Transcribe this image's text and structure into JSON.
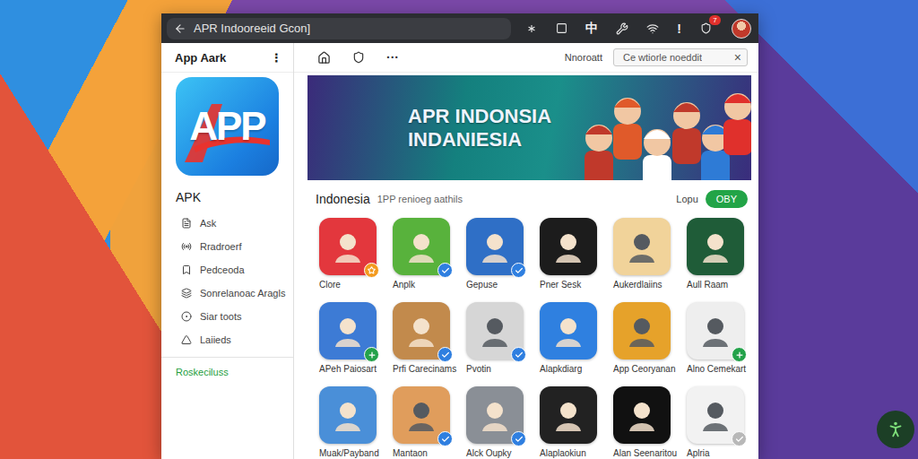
{
  "window": {
    "address": "APR Indooreeid Gcon]",
    "glyph": "中",
    "alert": "!",
    "notification_count": "7"
  },
  "sidebar": {
    "title": "App Aark",
    "menu": "⋮",
    "logo": "APP",
    "heading": "APK",
    "items": [
      {
        "label": "Ask"
      },
      {
        "label": "Rradroerf"
      },
      {
        "label": "Pedceoda"
      },
      {
        "label": "Sonrelanoac Aragls"
      },
      {
        "label": "Siar toots"
      },
      {
        "label": "Laiieds"
      }
    ],
    "footer": "Roskeciluss"
  },
  "header": {
    "more": "···",
    "label": "Nnoroatt",
    "search": {
      "placeholder": "Ce wtiorle noeddit",
      "clear": "×"
    }
  },
  "banner": {
    "lines": [
      "APR INDONSIA",
      "INDANIESIA"
    ]
  },
  "section": {
    "title": "Indonesia",
    "subtitle": "1PP renioeg aathils",
    "link": "Lopu",
    "button": "OBY"
  },
  "apps": [
    {
      "name": "Clore",
      "color": "#e3373d",
      "badge": "star"
    },
    {
      "name": "Anplk",
      "color": "#58b23c",
      "badge": "check"
    },
    {
      "name": "Gepuse",
      "color": "#2f6fc6",
      "badge": "check"
    },
    {
      "name": "Pner Sesk",
      "color": "#1c1c1c",
      "badge": "none"
    },
    {
      "name": "Aukerdlaiins",
      "color": "#f1d39a",
      "badge": "none"
    },
    {
      "name": "Aull Raam",
      "color": "#1f5c38",
      "badge": "none"
    },
    {
      "name": "APeh Paiosart",
      "color": "#3d7bd5",
      "badge": "plus"
    },
    {
      "name": "Prfi Carecinams",
      "color": "#c28a4c",
      "badge": "check"
    },
    {
      "name": "Pvotin",
      "color": "#d6d6d6",
      "badge": "check"
    },
    {
      "name": "Alapkdiarg",
      "color": "#2f80e0",
      "badge": "none"
    },
    {
      "name": "App Ceoryanan",
      "color": "#e6a22a",
      "badge": "none"
    },
    {
      "name": "Alno Cemekart",
      "color": "#eeeeee",
      "badge": "plus"
    },
    {
      "name": "Muak/Payband",
      "color": "#4a8fd8",
      "badge": "none"
    },
    {
      "name": "Mantaon",
      "color": "#e09d5c",
      "badge": "check"
    },
    {
      "name": "Alck Oupky",
      "color": "#8a8f96",
      "badge": "check"
    },
    {
      "name": "Alaplaokiun",
      "color": "#222222",
      "badge": "none"
    },
    {
      "name": "Alan Seenaritou",
      "color": "#111111",
      "badge": "none"
    },
    {
      "name": "Aplria",
      "color": "#f2f2f2",
      "badge": "grey"
    }
  ]
}
